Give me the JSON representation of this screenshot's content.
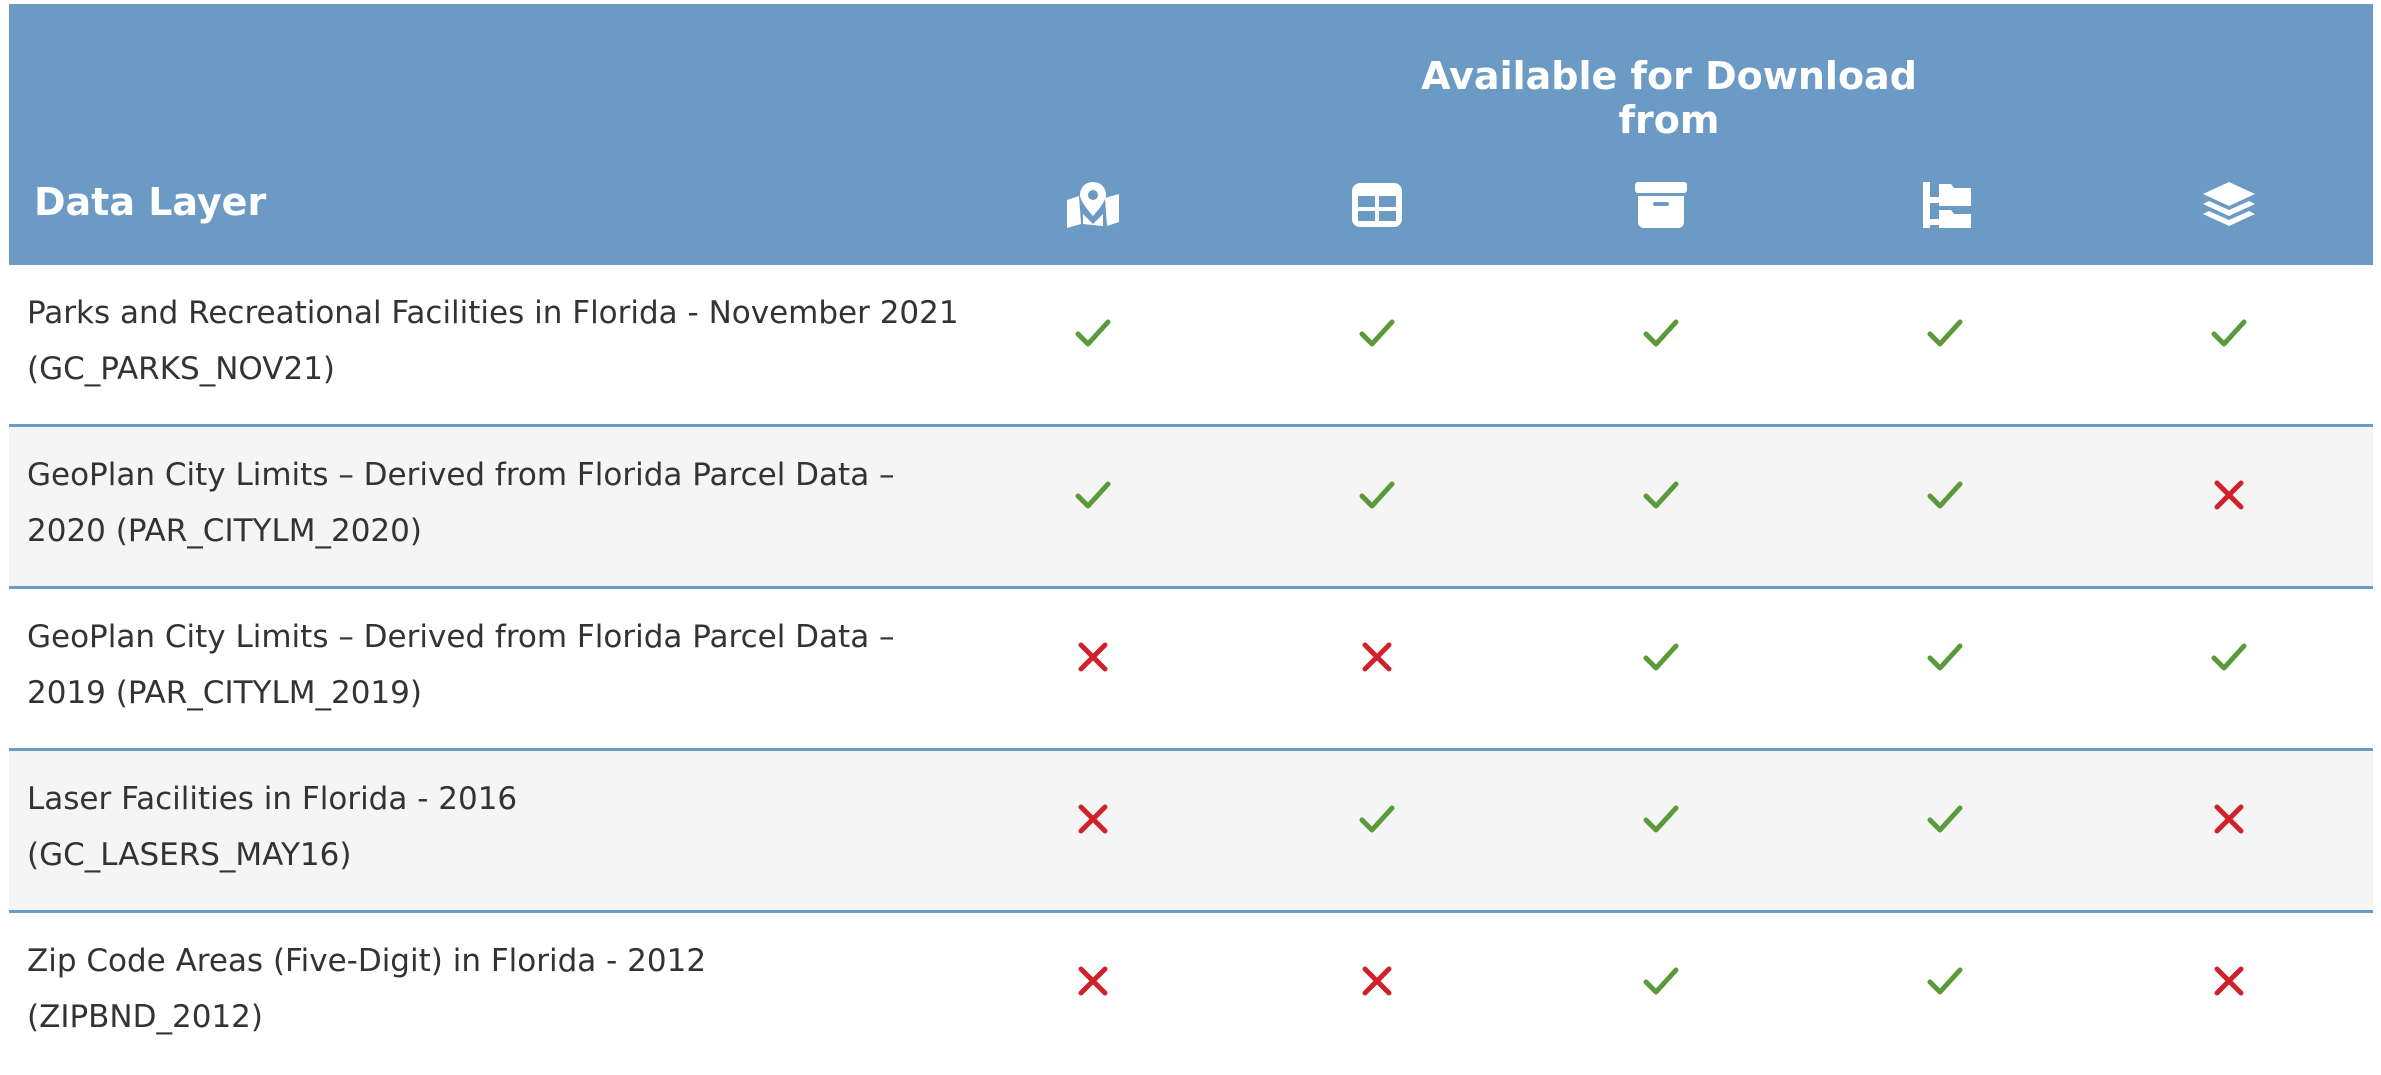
{
  "header": {
    "group_title": "Available for Download from",
    "first_column_title": "Data Layer",
    "icons": [
      "map-marker-icon",
      "table-icon",
      "archive-icon",
      "folder-tree-icon",
      "layers-icon"
    ]
  },
  "colors": {
    "header_bg": "#6b9ac4",
    "check": "#5a9a3a",
    "cross": "#d0212b",
    "row_alt_bg": "#f5f5f5"
  },
  "rows": [
    {
      "line1": "Parks and Recreational Facilities in Florida - November 2021",
      "line2": "(GC_PARKS_NOV21)",
      "availability": [
        true,
        true,
        true,
        true,
        true
      ]
    },
    {
      "line1": "GeoPlan City Limits – Derived from Florida Parcel Data –",
      "line2": "2020 (PAR_CITYLM_2020)",
      "availability": [
        true,
        true,
        true,
        true,
        false
      ]
    },
    {
      "line1": "GeoPlan City Limits – Derived from Florida Parcel Data –",
      "line2": "2019 (PAR_CITYLM_2019)",
      "availability": [
        false,
        false,
        true,
        true,
        true
      ]
    },
    {
      "line1": "Laser Facilities in Florida - 2016",
      "line2": "(GC_LASERS_MAY16)",
      "availability": [
        false,
        true,
        true,
        true,
        false
      ]
    },
    {
      "line1": "Zip Code Areas (Five-Digit) in Florida - 2012",
      "line2": "(ZIPBND_2012)",
      "availability": [
        false,
        false,
        true,
        true,
        false
      ]
    }
  ]
}
